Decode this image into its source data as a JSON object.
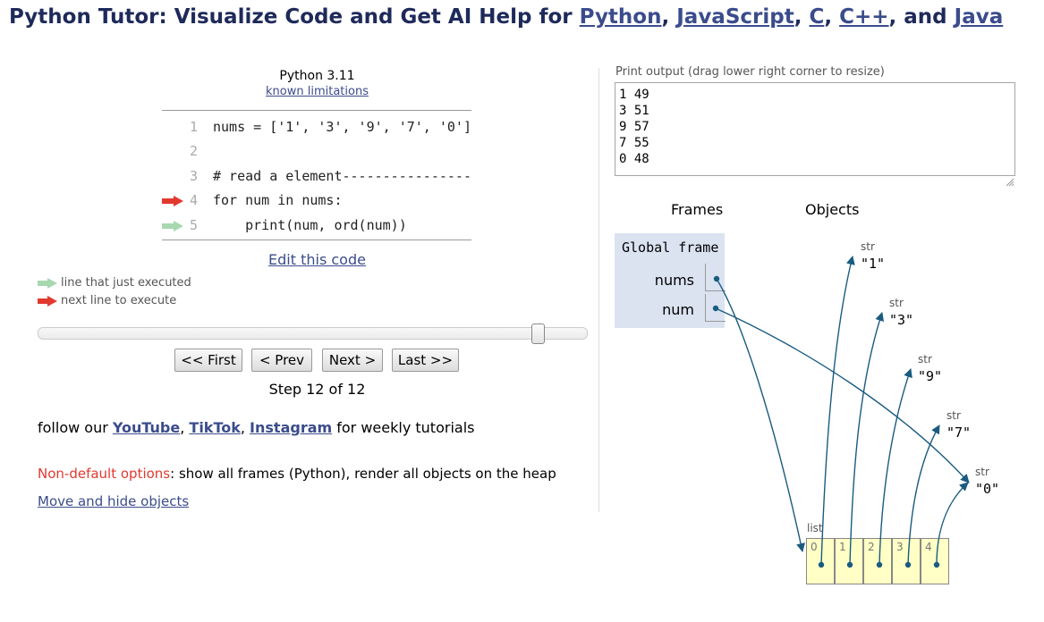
{
  "header": {
    "prefix": "Python Tutor: Visualize Code and Get AI Help for ",
    "langs": [
      "Python",
      "JavaScript",
      "C",
      "C++",
      "Java"
    ],
    "sep1": ", ",
    "sep2": ", ",
    "sep3": ", ",
    "sep4": ", and "
  },
  "editor": {
    "version": "Python 3.11",
    "limitations_link": "known limitations",
    "lines": [
      {
        "num": "1",
        "code": "nums = ['1', '3', '9', '7', '0']"
      },
      {
        "num": "2",
        "code": ""
      },
      {
        "num": "3",
        "code": "# read a element----------------"
      },
      {
        "num": "4",
        "code": "for num in nums:"
      },
      {
        "num": "5",
        "code": "    print(num, ord(num))"
      }
    ],
    "edit_link": "Edit this code"
  },
  "legend": {
    "executed": "line that just executed",
    "next": "next line to execute"
  },
  "navigation": {
    "first": "<< First",
    "prev": "< Prev",
    "next": "Next >",
    "last": "Last >>",
    "step_text": "Step 12 of 12",
    "step": 12,
    "total_steps": 12
  },
  "follow": {
    "prefix": "follow our ",
    "youtube": "YouTube",
    "tiktok": "TikTok",
    "instagram": "Instagram",
    "suffix": " for weekly tutorials",
    "c1": ", ",
    "c2": ", "
  },
  "options": {
    "label": "Non-default options",
    "text": ": show all frames (Python), render all objects on the heap",
    "move_hide": "Move and hide objects"
  },
  "output": {
    "label": "Print output (drag lower right corner to resize)",
    "lines": [
      "1 49",
      "3 51",
      "9 57",
      "7 55",
      "0 48"
    ]
  },
  "viz": {
    "frames_header": "Frames",
    "objects_header": "Objects",
    "global_frame": "Global frame",
    "vars": [
      {
        "name": "nums"
      },
      {
        "name": "num"
      }
    ],
    "strings": [
      {
        "type": "str",
        "value": "\"1\""
      },
      {
        "type": "str",
        "value": "\"3\""
      },
      {
        "type": "str",
        "value": "\"9\""
      },
      {
        "type": "str",
        "value": "\"7\""
      },
      {
        "type": "str",
        "value": "\"0\""
      }
    ],
    "list_label": "list",
    "list_indices": [
      "0",
      "1",
      "2",
      "3",
      "4"
    ]
  },
  "colors": {
    "link": "#3b4c8c",
    "arrow_red": "#e2392f",
    "arrow_green": "#a8d8b0",
    "pointer": "#1a5b80",
    "frame_bg": "#dbe3f1",
    "list_bg": "#ffffc6"
  }
}
